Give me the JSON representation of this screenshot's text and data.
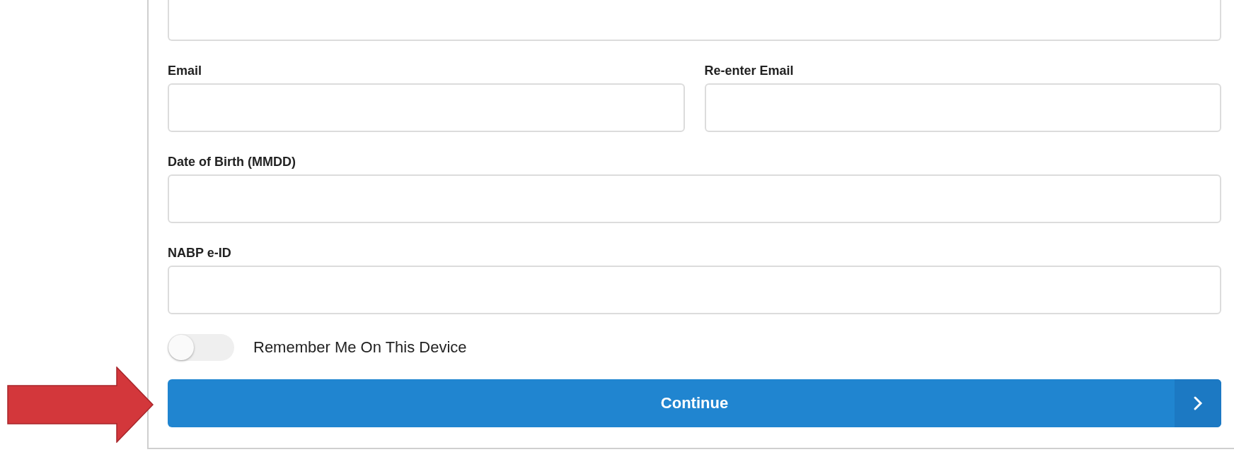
{
  "field_rows": [
    [
      {
        "label": "Email"
      },
      {
        "label": "Re-enter Email"
      }
    ],
    [
      {
        "label": "Date of Birth (MMDD)"
      }
    ],
    [
      {
        "label": "NABP e-ID"
      }
    ]
  ],
  "remember_toggle": {
    "label": "Remember Me On This Device",
    "on": false
  },
  "continue_button": {
    "label": "Continue"
  }
}
